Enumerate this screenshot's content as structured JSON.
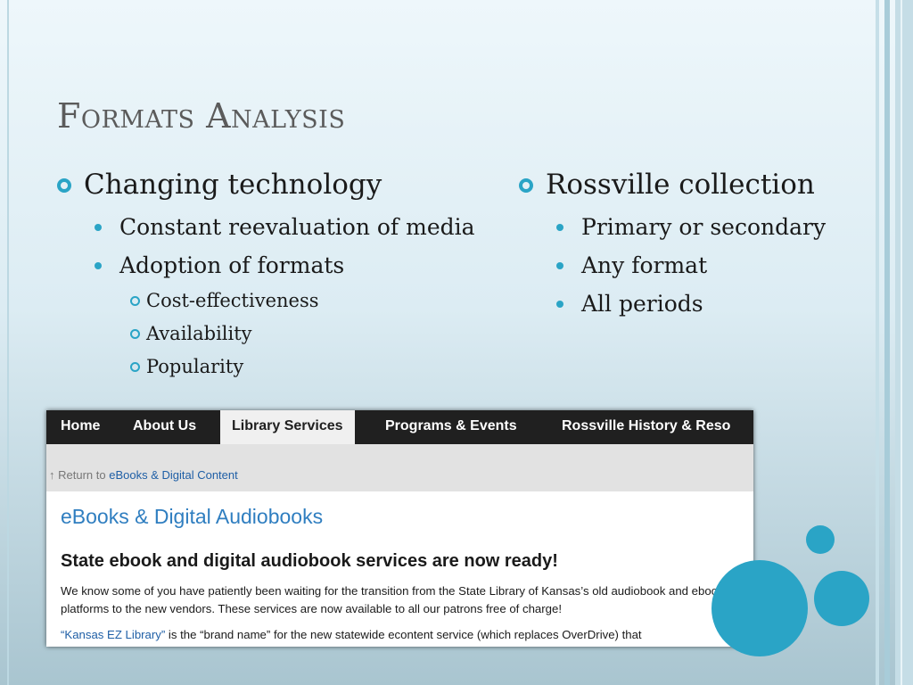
{
  "slide": {
    "title": "Formats Analysis",
    "left_column": {
      "heading": "Changing technology",
      "items": [
        {
          "label": "Constant reevaluation of media"
        },
        {
          "label": "Adoption of formats",
          "subitems": [
            "Cost-effectiveness",
            "Availability",
            "Popularity"
          ]
        }
      ]
    },
    "right_column": {
      "heading": "Rossville collection",
      "items": [
        "Primary or secondary",
        "Any format",
        "All periods"
      ]
    }
  },
  "screenshot": {
    "nav": [
      "Home",
      "About Us",
      "Library Services",
      "Programs & Events",
      "Rossville History & Reso"
    ],
    "active_nav": "Library Services",
    "breadcrumb": {
      "prefix": "↑ Return to",
      "link": "eBooks & Digital Content"
    },
    "page_title": "eBooks & Digital Audiobooks",
    "headline": "State ebook and digital audiobook services are now ready!",
    "paragraph1": "We know some of you have patiently been waiting for the transition from the State Library of Kansas’s old audiobook and ebook platforms to the new vendors. These services are now available to all our patrons free of charge!",
    "paragraph2_link": "“Kansas EZ Library”",
    "paragraph2_text": " is the “brand name” for the new statewide econtent service (which replaces OverDrive) that"
  },
  "colors": {
    "accent": "#2aa4c6",
    "title": "#5b5b5b",
    "link": "#1f5fa6"
  }
}
